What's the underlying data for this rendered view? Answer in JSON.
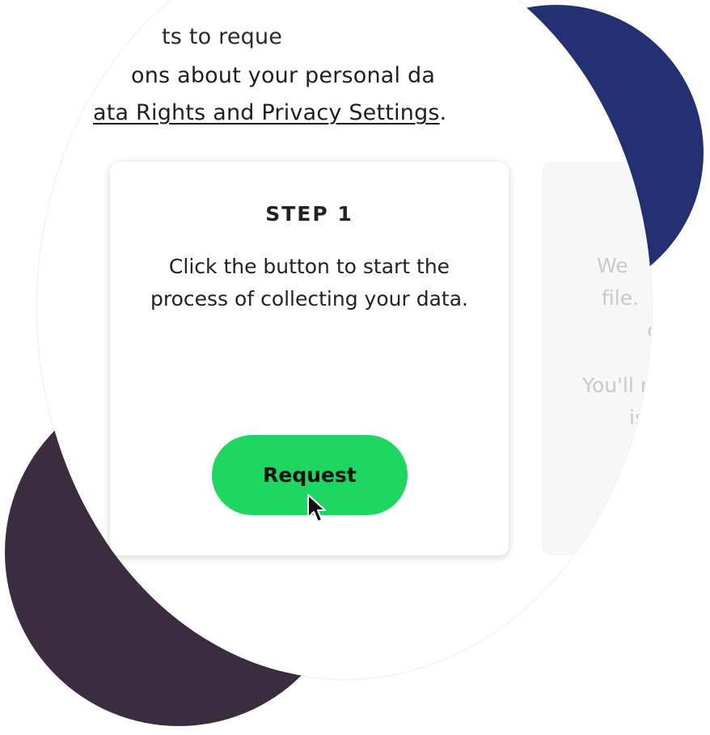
{
  "intro": {
    "line1": "ts to reque",
    "line2": "ons about your personal da",
    "link": "ata Rights and Privacy Settings",
    "period": "."
  },
  "step1": {
    "title": "STEP 1",
    "description": "Click the button to start the process of collecting your data.",
    "button_label": "Request",
    "button_color": "#1ed760"
  },
  "step2_partial": {
    "lines": [
      "We",
      "file.",
      "c",
      "You'll r",
      "is"
    ]
  },
  "decor": {
    "blue_circle": "#233172",
    "plum_circle": "#3c2c40"
  },
  "cursor_icon": "arrow-pointer-icon"
}
